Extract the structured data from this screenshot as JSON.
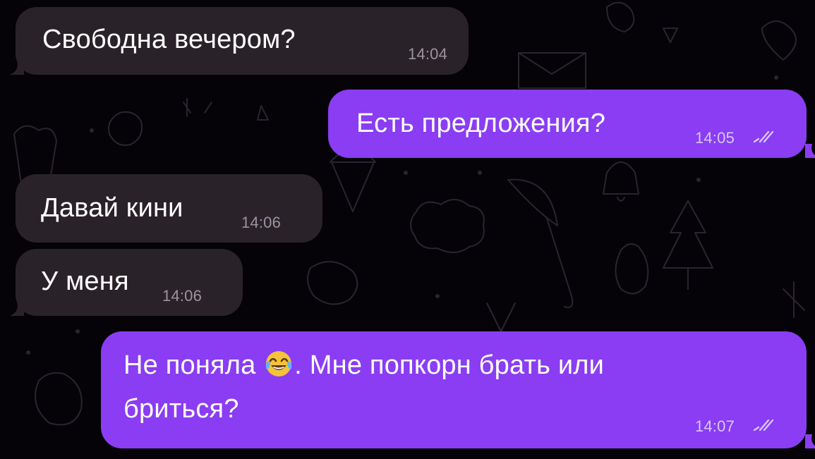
{
  "chat": {
    "messages": [
      {
        "direction": "incoming",
        "text": "Свободна вечером?",
        "time": "14:04"
      },
      {
        "direction": "outgoing",
        "text": "Есть предложения?",
        "time": "14:05",
        "status": "read-double-check"
      },
      {
        "direction": "incoming",
        "text": "Давай кини",
        "time": "14:06"
      },
      {
        "direction": "incoming",
        "text": "У меня",
        "time": "14:06"
      },
      {
        "direction": "outgoing",
        "text_before_emoji": "Не поняла ",
        "emoji": "face-with-tears-of-joy",
        "text_after_emoji": ". Мне попкорн брать или",
        "text_line2": "бриться?",
        "time": "14:07",
        "status": "read-double-check"
      }
    ]
  },
  "colors": {
    "background": "#050307",
    "incoming_bubble": "#2a2229",
    "outgoing_bubble": "#8a3df2",
    "text": "#ffffff",
    "incoming_time": "#9c93a0",
    "outgoing_time": "#d9c6ff"
  }
}
